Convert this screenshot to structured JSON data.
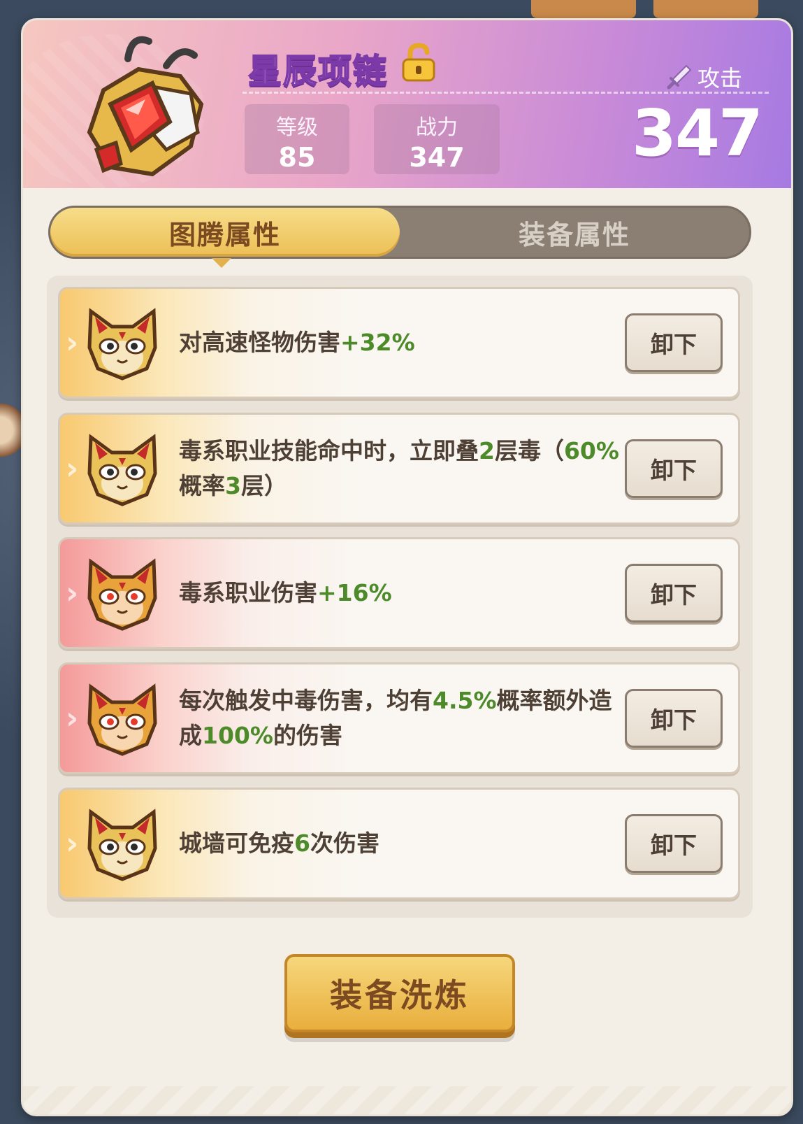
{
  "background": {
    "top_cards": [
      "85级",
      "85级"
    ]
  },
  "item": {
    "name": "星辰项链",
    "icon": "star-necklace-icon",
    "lock_icon": "unlock-icon",
    "level_label": "等级",
    "level_value": "85",
    "power_label": "战力",
    "power_value": "347",
    "stat_type_label": "攻击",
    "stat_type_icon": "sword-icon",
    "stat_value": "347"
  },
  "tabs": [
    {
      "label": "图腾属性",
      "active": true
    },
    {
      "label": "装备属性",
      "active": false
    }
  ],
  "totems": [
    {
      "mask": "gold-cat-mask-icon",
      "tier": "gold",
      "parts": [
        [
          "对高速怪物伤害",
          false
        ],
        [
          "+32%",
          true
        ]
      ],
      "action": "卸下"
    },
    {
      "mask": "gold-cat-mask-icon",
      "tier": "gold",
      "parts": [
        [
          "毒系职业技能命中时，立即叠",
          false
        ],
        [
          "2",
          true
        ],
        [
          "层毒（",
          false
        ],
        [
          "60%",
          true
        ],
        [
          "概率",
          false
        ],
        [
          "3",
          true
        ],
        [
          "层）",
          false
        ]
      ],
      "action": "卸下"
    },
    {
      "mask": "red-cat-mask-icon",
      "tier": "red",
      "parts": [
        [
          "毒系职业伤害",
          false
        ],
        [
          "+16%",
          true
        ]
      ],
      "action": "卸下"
    },
    {
      "mask": "red-cat-mask-icon",
      "tier": "red",
      "parts": [
        [
          "每次触发中毒伤害，均有",
          false
        ],
        [
          "4.5%",
          true
        ],
        [
          "概率额外造成",
          false
        ],
        [
          "100%",
          true
        ],
        [
          "的伤害",
          false
        ]
      ],
      "action": "卸下"
    },
    {
      "mask": "gold-cat-mask-icon",
      "tier": "gold",
      "parts": [
        [
          "城墙可免疫",
          false
        ],
        [
          "6",
          true
        ],
        [
          "次伤害",
          false
        ]
      ],
      "action": "卸下"
    }
  ],
  "footer": {
    "refine_label": "装备洗炼"
  },
  "colors": {
    "highlight": "#4d8b2a",
    "accent_gold": "#ecbf55",
    "header_purple": "#a67ae2"
  }
}
